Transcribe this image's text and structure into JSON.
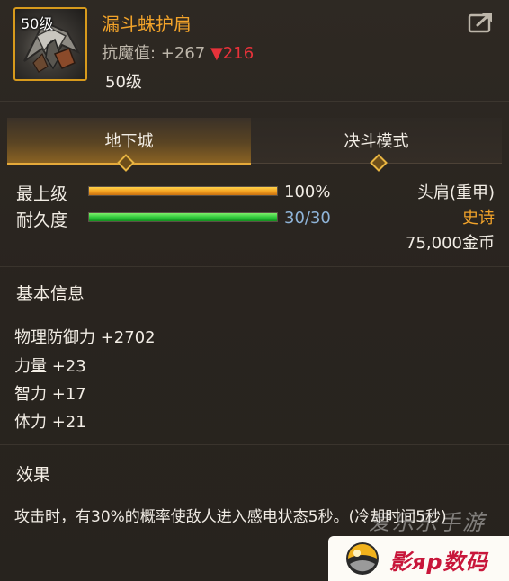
{
  "item": {
    "icon_level": "50级",
    "name": "漏斗蛛护肩",
    "anti_magic_label": "抗魔值: +267",
    "anti_magic_down": "▼216",
    "level_requirement": "50级"
  },
  "tabs": [
    {
      "label": "地下城",
      "active": true
    },
    {
      "label": "决斗模式",
      "active": false
    }
  ],
  "progress": [
    {
      "label": "最上级",
      "value_text": "100%",
      "fraction": 1.0,
      "color": "#f3a020"
    },
    {
      "label": "耐久度",
      "value_text": "30/30",
      "fraction": 1.0,
      "color": "#2cc53a"
    }
  ],
  "side_info": {
    "slot": "头肩(重甲)",
    "rarity": "史诗",
    "price": "75,000金币"
  },
  "basic_info": {
    "title": "基本信息",
    "attributes": [
      "物理防御力 +2702",
      "力量 +23",
      "智力 +17",
      "体力 +21"
    ]
  },
  "effect": {
    "title": "效果",
    "text": "攻击时，有30%的概率使敌人进入感电状态5秒。(冷却时间5秒)"
  },
  "watermark": {
    "text": "爱乐乐手游",
    "badge_text": "影яр数码"
  },
  "colors": {
    "accent": "#f2a32a",
    "rarity": "#f2a32a",
    "down": "#e8323a",
    "durability_value": "#8fb4d8"
  }
}
